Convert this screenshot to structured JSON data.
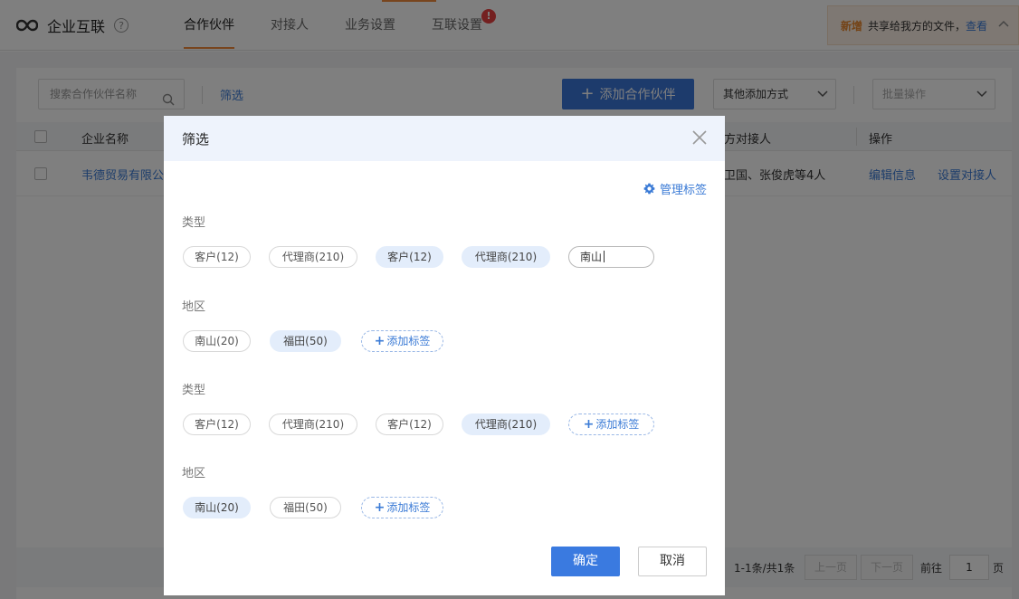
{
  "header": {
    "app_title": "企业互联",
    "help_label": "?",
    "tabs": [
      {
        "label": "合作伙伴",
        "active": true
      },
      {
        "label": "对接人",
        "active": false
      },
      {
        "label": "业务设置",
        "active": false
      },
      {
        "label": "互联设置",
        "active": false,
        "badge": "!"
      }
    ],
    "notice": {
      "new_label": "新增",
      "text": "共享给我方的文件，",
      "link": "查看"
    }
  },
  "toolbar": {
    "search_placeholder": "搜索合作伙伴名称",
    "filter_label": "筛选",
    "add_button": "添加合作伙伴",
    "other_add_select": "其他添加方式",
    "batch_select": "批量操作"
  },
  "table": {
    "headers": [
      "企业名称",
      "方对接人",
      "操作"
    ],
    "rows": [
      {
        "name": "韦德贸易有限公",
        "contacts": "卫国、张俊虎等4人",
        "actions": [
          "编辑信息",
          "设置对接人"
        ]
      }
    ]
  },
  "pagination": {
    "info": "1-1条/共1条",
    "prev": "上一页",
    "next": "下一页",
    "goto": "前往",
    "page": "1",
    "page_suffix": "页"
  },
  "modal": {
    "title": "筛选",
    "manage_tags": "管理标签",
    "sections": [
      {
        "label": "类型",
        "tags": [
          "客户(12)",
          "代理商(210)",
          "客户(12)",
          "代理商(210)"
        ],
        "selected": [
          false,
          false,
          true,
          true
        ],
        "input_value": "南山"
      },
      {
        "label": "地区",
        "tags": [
          "南山(20)",
          "福田(50)"
        ],
        "selected": [
          false,
          true
        ],
        "add_label": "添加标签"
      },
      {
        "label": "类型",
        "tags": [
          "客户(12)",
          "代理商(210)",
          "客户(12)",
          "代理商(210)"
        ],
        "selected": [
          false,
          false,
          false,
          true
        ],
        "add_label": "添加标签"
      },
      {
        "label": "地区",
        "tags": [
          "南山(20)",
          "福田(50)"
        ],
        "selected": [
          true,
          false
        ],
        "add_label": "添加标签"
      }
    ],
    "confirm": "确定",
    "cancel": "取消"
  },
  "colors": {
    "primary": "#3a76d8",
    "accent_orange": "#f08a3c",
    "tag_selected_bg": "#e3edfb",
    "badge_red": "#e84040"
  }
}
